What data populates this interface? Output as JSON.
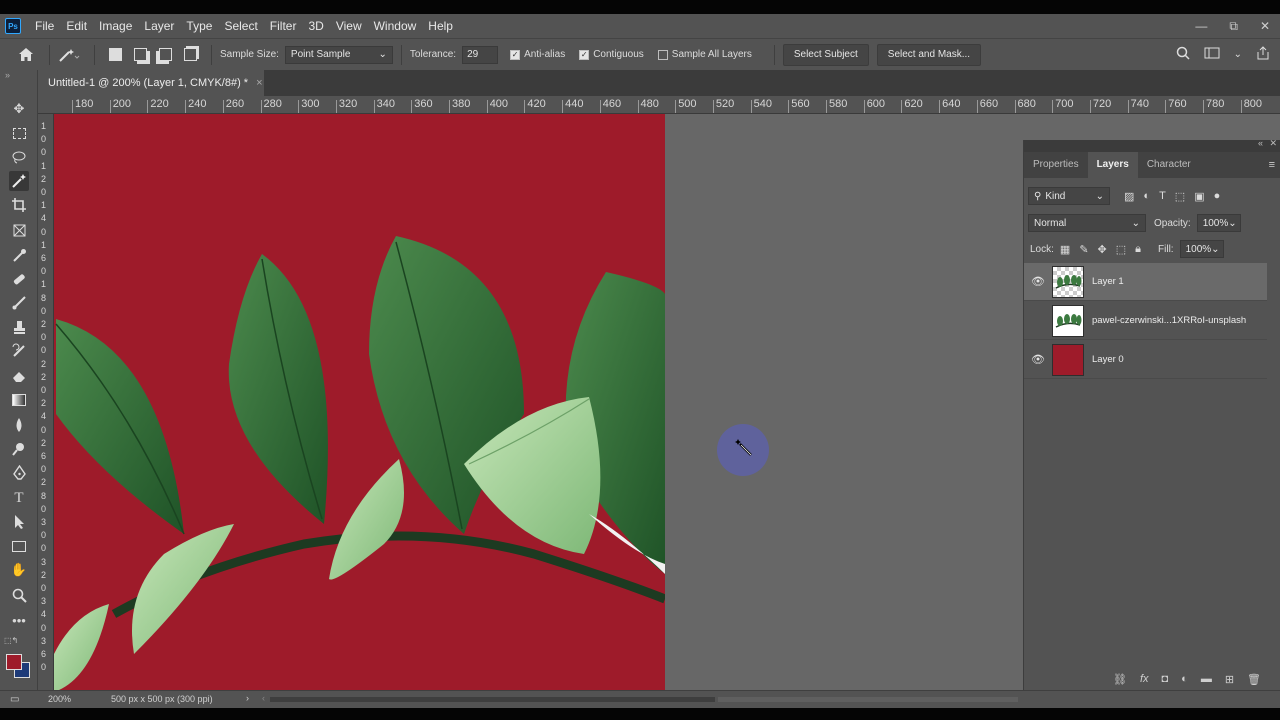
{
  "app": {
    "logo": "Ps"
  },
  "menu": [
    "File",
    "Edit",
    "Image",
    "Layer",
    "Type",
    "Select",
    "Filter",
    "3D",
    "View",
    "Window",
    "Help"
  ],
  "window_controls": {
    "minimize": "—",
    "restore": "⧉",
    "close": "✕"
  },
  "options": {
    "sample_size_label": "Sample Size:",
    "sample_size_value": "Point Sample",
    "tolerance_label": "Tolerance:",
    "tolerance_value": "29",
    "anti_alias_label": "Anti-alias",
    "anti_alias_checked": true,
    "contiguous_label": "Contiguous",
    "contiguous_checked": true,
    "sample_all_layers_label": "Sample All Layers",
    "sample_all_layers_checked": false,
    "select_subject_label": "Select Subject",
    "select_mask_label": "Select and Mask..."
  },
  "document_tab": {
    "title": "Untitled-1 @ 200% (Layer 1, CMYK/8#) *",
    "close": "×"
  },
  "ruler_h": [
    "180",
    "200",
    "220",
    "240",
    "260",
    "280",
    "300",
    "320",
    "340",
    "360",
    "380",
    "400",
    "420",
    "440",
    "460",
    "480",
    "500",
    "520",
    "540",
    "560",
    "580",
    "600",
    "620",
    "640",
    "660",
    "680",
    "700",
    "720",
    "740",
    "760",
    "780",
    "800"
  ],
  "ruler_v": [
    "1",
    "0",
    "0",
    "1",
    "2",
    "0",
    "1",
    "4",
    "0",
    "1",
    "6",
    "0",
    "1",
    "8",
    "0",
    "2",
    "0",
    "0",
    "2",
    "2",
    "0",
    "2",
    "4",
    "0",
    "2",
    "6",
    "0",
    "2",
    "8",
    "0",
    "3",
    "0",
    "0",
    "3",
    "2",
    "0",
    "3",
    "4",
    "0",
    "3",
    "6",
    "0"
  ],
  "status": {
    "zoom": "200%",
    "doc_info": "500 px x 500 px (300 ppi)"
  },
  "panel": {
    "tabs": [
      "Properties",
      "Layers",
      "Character"
    ],
    "active_tab": "Layers",
    "filter_kind": "Kind",
    "blend_mode": "Normal",
    "opacity_label": "Opacity:",
    "opacity_value": "100%",
    "lock_label": "Lock:",
    "fill_label": "Fill:",
    "fill_value": "100%",
    "layers": [
      {
        "name": "Layer 1",
        "visible": true,
        "selected": true
      },
      {
        "name": "pawel-czerwinski...1XRRoI-unsplash",
        "visible": false,
        "selected": false
      },
      {
        "name": "Layer 0",
        "visible": true,
        "selected": false
      }
    ]
  },
  "colors": {
    "canvas_red": "#9e1b2a",
    "leaf_dark": "#2f6b35",
    "leaf_light": "#9ccf8f",
    "ui_gray": "#535353",
    "pasteboard": "#676767"
  }
}
